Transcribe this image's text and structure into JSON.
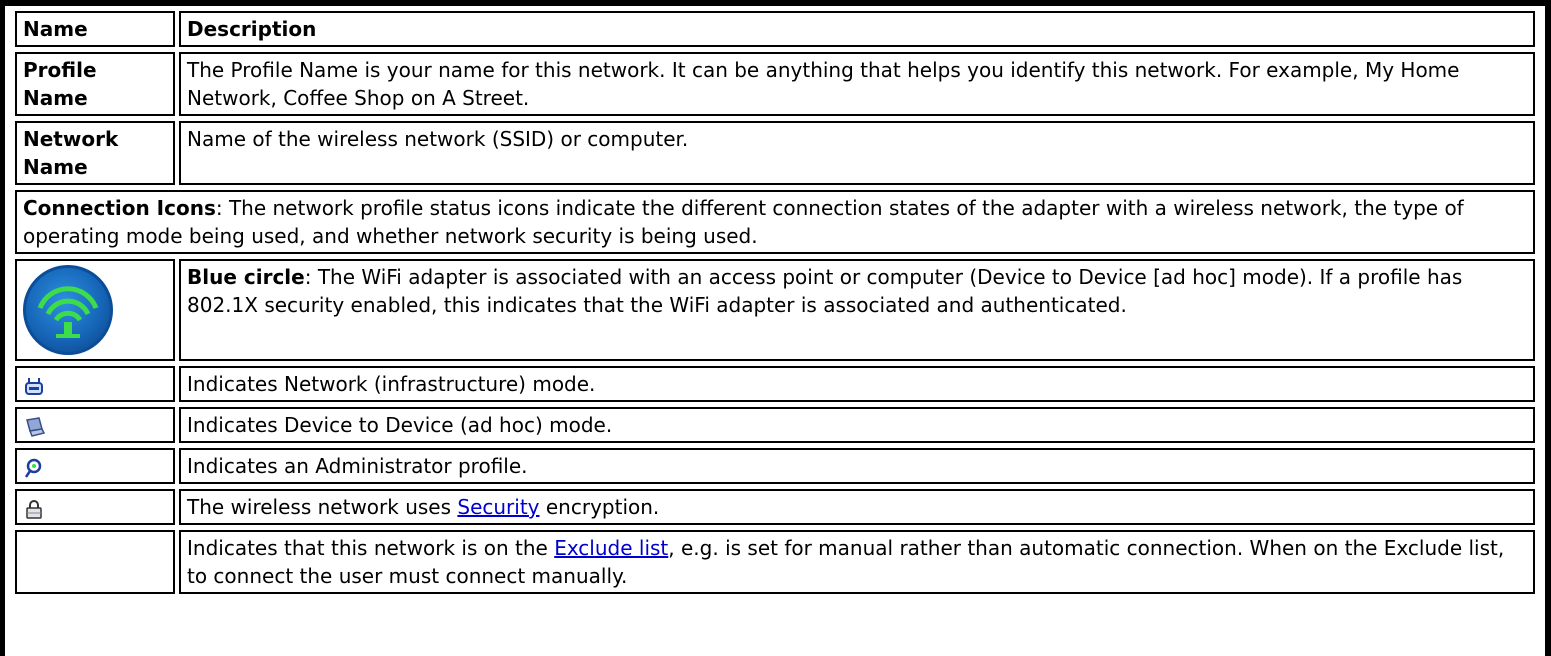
{
  "header": {
    "name": "Name",
    "description": "Description"
  },
  "rows": {
    "profile_name": {
      "name": "Profile Name",
      "description": "The Profile Name is your name for this network. It can be anything that helps you identify this network. For example, My Home Network, Coffee Shop on A Street."
    },
    "network_name": {
      "name": "Network Name",
      "description": "Name of the wireless network (SSID) or computer."
    }
  },
  "connection_icons": {
    "title": "Connection Icons",
    "text": ": The network profile status icons indicate the different connection states of the adapter with a wireless network, the type of operating mode being used, and whether network security is being used."
  },
  "icon_rows": {
    "blue_circle": {
      "icon": "wifi-signal-blue-circle-icon",
      "label": "Blue circle",
      "text": ": The WiFi adapter is associated with an access point or computer (Device to Device [ad hoc] mode). If a profile has 802.1X security enabled, this indicates that the WiFi adapter is associated and authenticated."
    },
    "infrastructure": {
      "icon": "network-infrastructure-icon",
      "text": "Indicates Network (infrastructure) mode."
    },
    "adhoc": {
      "icon": "laptop-adhoc-icon",
      "text": "Indicates Device to Device (ad hoc) mode."
    },
    "admin": {
      "icon": "administrator-profile-icon",
      "text": "Indicates an Administrator profile."
    },
    "security": {
      "icon": "lock-icon",
      "text_before": "The wireless network uses ",
      "link": "Security",
      "text_after": " encryption."
    },
    "exclude": {
      "text_before": "Indicates that this network is on the ",
      "link": "Exclude list",
      "text_after": ", e.g. is set for manual rather than automatic connection. When on the Exclude list, to connect the user must connect manually."
    }
  },
  "colors": {
    "link": "#0000cc",
    "icon_blue": "#1666b8",
    "icon_green": "#3ddc4a"
  }
}
